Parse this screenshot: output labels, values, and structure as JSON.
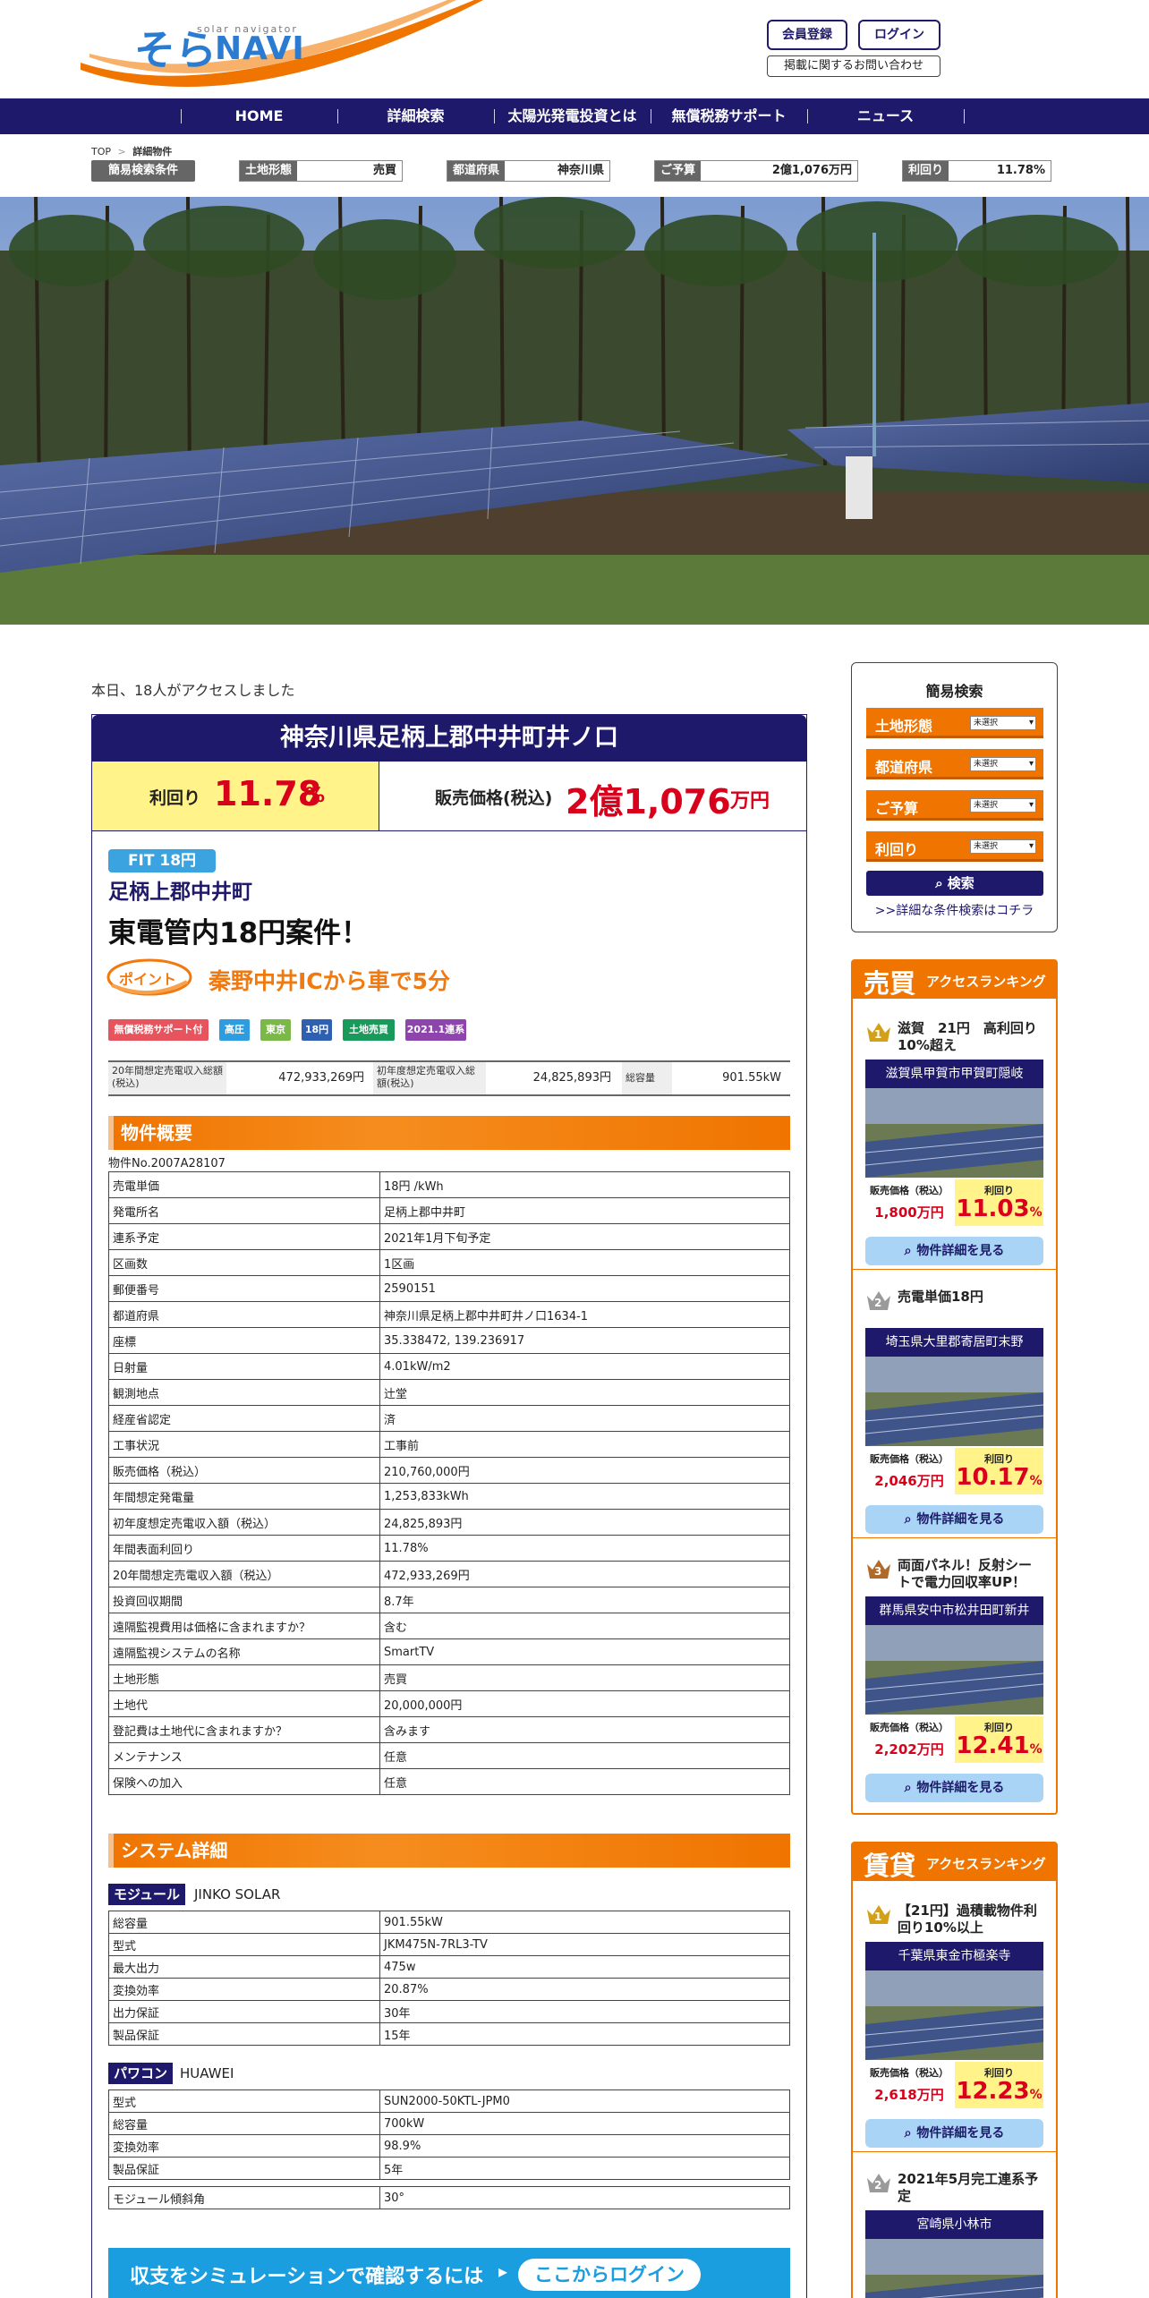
{
  "header": {
    "logo_sub": "solar navigator",
    "logo_main": "そら",
    "logo_navi": "NAVI",
    "register_label": "会員登録",
    "login_label": "ログイン",
    "contact_label": "掲載に関するお問い合わせ"
  },
  "nav": [
    "HOME",
    "詳細検索",
    "太陽光発電投資とは",
    "無償税務サポート",
    "ニュース"
  ],
  "breadcrumb": {
    "top": "TOP",
    "sep": ">",
    "current": "詳細物件"
  },
  "quick_conditions": {
    "label": "簡易検索条件",
    "items": [
      {
        "key": "土地形態",
        "value": "売買"
      },
      {
        "key": "都道府県",
        "value": "神奈川県"
      },
      {
        "key": "ご予算",
        "value": "2億1,076万円"
      },
      {
        "key": "利回り",
        "value": "11.78%"
      }
    ]
  },
  "access_text": "本日、18人がアクセスしました",
  "property": {
    "title": "神奈川県足柄上郡中井町井ノ口",
    "yield_label": "利回り",
    "yield_value": "11.78",
    "yield_unit": "%",
    "price_label": "販売価格(税込)",
    "price_value": "2億1,076",
    "price_unit": "万円",
    "fit_badge": "FIT 18円",
    "area_name": "足柄上郡中井町",
    "catch": "東電管内18円案件！",
    "point_badge": "ポイント",
    "point_text": "秦野中井ICから車で5分",
    "tags": [
      {
        "label": "無償税務サポート付",
        "color": "#e8545e"
      },
      {
        "label": "高圧",
        "color": "#2e9ce0"
      },
      {
        "label": "東京",
        "color": "#7ab848"
      },
      {
        "label": "18円",
        "color": "#2f5fb0"
      },
      {
        "label": "土地売買",
        "color": "#1a9a5a"
      },
      {
        "label": "2021.1連系",
        "color": "#8e44ad"
      }
    ],
    "summary": [
      {
        "key": "20年間想定売電収入総額(税込)",
        "value": "472,933,269円"
      },
      {
        "key": "初年度想定売電収入総額(税込)",
        "value": "24,825,893円"
      },
      {
        "key": "総容量",
        "value": "901.55kW"
      }
    ],
    "overview_heading": "物件概要",
    "property_no": "物件No.2007A28107",
    "overview": [
      {
        "k": "売電単価",
        "v": "18円 /kWh"
      },
      {
        "k": "発電所名",
        "v": "足柄上郡中井町"
      },
      {
        "k": "連系予定",
        "v": "2021年1月下旬予定"
      },
      {
        "k": "区画数",
        "v": "1区画"
      },
      {
        "k": "郵便番号",
        "v": "2590151"
      },
      {
        "k": "都道府県",
        "v": "神奈川県足柄上郡中井町井ノ口1634-1"
      },
      {
        "k": "座標",
        "v": "35.338472, 139.236917"
      },
      {
        "k": "日射量",
        "v": "4.01kW/m2"
      },
      {
        "k": "観測地点",
        "v": "辻堂"
      },
      {
        "k": "経産省認定",
        "v": "済"
      },
      {
        "k": "工事状況",
        "v": "工事前"
      },
      {
        "k": "販売価格（税込）",
        "v": "210,760,000円"
      },
      {
        "k": "年間想定発電量",
        "v": "1,253,833kWh"
      },
      {
        "k": "初年度想定売電収入額（税込）",
        "v": "24,825,893円"
      },
      {
        "k": "年間表面利回り",
        "v": "11.78%"
      },
      {
        "k": "20年間想定売電収入額（税込）",
        "v": "472,933,269円"
      },
      {
        "k": "投資回収期間",
        "v": "8.7年"
      },
      {
        "k": "遠隔監視費用は価格に含まれますか？",
        "v": "含む"
      },
      {
        "k": "遠隔監視システムの名称",
        "v": "SmartTV"
      },
      {
        "k": "土地形態",
        "v": "売買"
      },
      {
        "k": "土地代",
        "v": "20,000,000円"
      },
      {
        "k": "登記費は土地代に含まれますか？",
        "v": "含みます"
      },
      {
        "k": "メンテナンス",
        "v": "任意"
      },
      {
        "k": "保険への加入",
        "v": "任意"
      }
    ],
    "system_heading": "システム詳細",
    "module_label": "モジュール",
    "module_maker": "JINKO SOLAR",
    "module": [
      {
        "k": "総容量",
        "v": "901.55kW"
      },
      {
        "k": "型式",
        "v": "JKM475N-7RL3-TV"
      },
      {
        "k": "最大出力",
        "v": "475w"
      },
      {
        "k": "変換効率",
        "v": "20.87%"
      },
      {
        "k": "出力保証",
        "v": "30年"
      },
      {
        "k": "製品保証",
        "v": "15年"
      }
    ],
    "pcs_label": "パワコン",
    "pcs_maker": "HUAWEI",
    "pcs": [
      {
        "k": "型式",
        "v": "SUN2000-50KTL-JPM0"
      },
      {
        "k": "総容量",
        "v": "700kW"
      },
      {
        "k": "変換効率",
        "v": "98.9%"
      },
      {
        "k": "製品保証",
        "v": "5年"
      }
    ],
    "tilt": {
      "k": "モジュール傾斜角",
      "v": "30°"
    },
    "login_banner_text": "収支をシミュレーションで確認するには",
    "login_banner_arrow": "▸",
    "login_banner_button": "ここからログイン"
  },
  "sidebar": {
    "search_title": "簡易検索",
    "search_rows": [
      {
        "label": "土地形態",
        "select": "未選択"
      },
      {
        "label": "都道府県",
        "select": "未選択"
      },
      {
        "label": "ご予算",
        "select": "未選択"
      },
      {
        "label": "利回り",
        "select": "未選択"
      }
    ],
    "search_button": "⌕ 検索",
    "search_link": ">>詳細な条件検索はコチラ",
    "sale_ranking": {
      "head_big": "売買",
      "head_small": "アクセスランキング",
      "items": [
        {
          "rank": "1",
          "title": "滋賀　21円　高利回り10%超え",
          "area": "滋賀県甲賀市甲賀町隠岐",
          "price_label": "販売価格（税込）",
          "price": "1,800万円",
          "yield_label": "利回り",
          "yield": "11.03",
          "unit": "%",
          "button": "物件詳細を見る"
        },
        {
          "rank": "2",
          "title": "売電単価18円",
          "area": "埼玉県大里郡寄居町末野",
          "price_label": "販売価格（税込）",
          "price": "2,046万円",
          "yield_label": "利回り",
          "yield": "10.17",
          "unit": "%",
          "button": "物件詳細を見る"
        },
        {
          "rank": "3",
          "title": "両面パネル！反射シートで電力回収率UP！",
          "area": "群馬県安中市松井田町新井",
          "price_label": "販売価格（税込）",
          "price": "2,202万円",
          "yield_label": "利回り",
          "yield": "12.41",
          "unit": "%",
          "button": "物件詳細を見る"
        }
      ]
    },
    "rent_ranking": {
      "head_big": "賃貸",
      "head_small": "アクセスランキング",
      "items": [
        {
          "rank": "1",
          "title": "【21円】過積載物件利回り10%以上",
          "area": "千葉県東金市極楽寺",
          "price_label": "販売価格（税込）",
          "price": "2,618万円",
          "yield_label": "利回り",
          "yield": "12.23",
          "unit": "%",
          "button": "物件詳細を見る"
        },
        {
          "rank": "2",
          "title": "2021年5月完工連系予定",
          "area": "宮崎県小林市"
        }
      ]
    }
  },
  "colors": {
    "navy": "#1e196b",
    "orange": "#f07400",
    "red": "#d9001b",
    "yellow": "#fff38a",
    "blue": "#1a9ee0"
  }
}
